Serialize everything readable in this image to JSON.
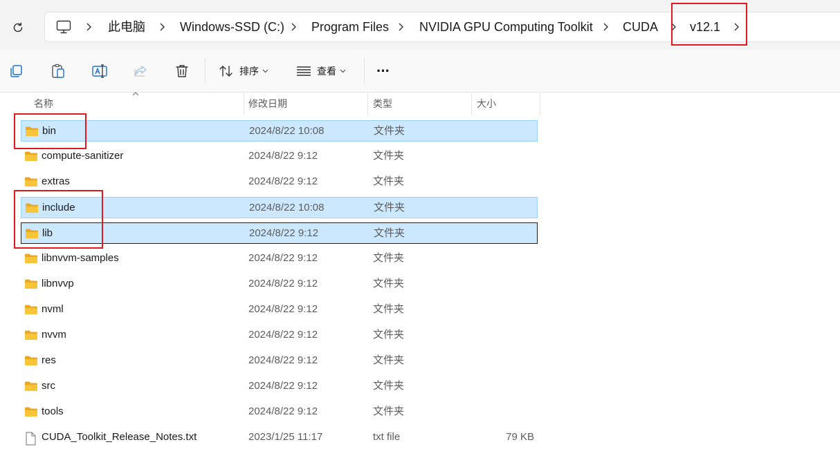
{
  "address_bar": {
    "breadcrumbs": [
      {
        "label": "此电脑"
      },
      {
        "label": "Windows-SSD (C:)"
      },
      {
        "label": "Program Files"
      },
      {
        "label": "NVIDIA GPU Computing Toolkit"
      },
      {
        "label": "CUDA"
      },
      {
        "label": "v12.1"
      }
    ]
  },
  "toolbar": {
    "sort_label": "排序",
    "view_label": "查看",
    "more_label": "···"
  },
  "columns": {
    "name": "名称",
    "date": "修改日期",
    "type": "类型",
    "size": "大小"
  },
  "files": [
    {
      "name": "bin",
      "date": "2024/8/22 10:08",
      "type": "文件夹",
      "size": "",
      "kind": "folder",
      "selected": true
    },
    {
      "name": "compute-sanitizer",
      "date": "2024/8/22 9:12",
      "type": "文件夹",
      "size": "",
      "kind": "folder",
      "selected": false
    },
    {
      "name": "extras",
      "date": "2024/8/22 9:12",
      "type": "文件夹",
      "size": "",
      "kind": "folder",
      "selected": false
    },
    {
      "name": "include",
      "date": "2024/8/22 10:08",
      "type": "文件夹",
      "size": "",
      "kind": "folder",
      "selected": true
    },
    {
      "name": "lib",
      "date": "2024/8/22 9:12",
      "type": "文件夹",
      "size": "",
      "kind": "folder",
      "selected": true,
      "focused": true
    },
    {
      "name": "libnvvm-samples",
      "date": "2024/8/22 9:12",
      "type": "文件夹",
      "size": "",
      "kind": "folder",
      "selected": false
    },
    {
      "name": "libnvvp",
      "date": "2024/8/22 9:12",
      "type": "文件夹",
      "size": "",
      "kind": "folder",
      "selected": false
    },
    {
      "name": "nvml",
      "date": "2024/8/22 9:12",
      "type": "文件夹",
      "size": "",
      "kind": "folder",
      "selected": false
    },
    {
      "name": "nvvm",
      "date": "2024/8/22 9:12",
      "type": "文件夹",
      "size": "",
      "kind": "folder",
      "selected": false
    },
    {
      "name": "res",
      "date": "2024/8/22 9:12",
      "type": "文件夹",
      "size": "",
      "kind": "folder",
      "selected": false
    },
    {
      "name": "src",
      "date": "2024/8/22 9:12",
      "type": "文件夹",
      "size": "",
      "kind": "folder",
      "selected": false
    },
    {
      "name": "tools",
      "date": "2024/8/22 9:12",
      "type": "文件夹",
      "size": "",
      "kind": "folder",
      "selected": false
    },
    {
      "name": "CUDA_Toolkit_Release_Notes.txt",
      "date": "2023/1/25 11:17",
      "type": "txt file",
      "size": "79 KB",
      "kind": "file",
      "selected": false
    }
  ],
  "colors": {
    "selection_bg": "#cce8ff",
    "selection_border": "#99d1ff",
    "annotation_red": "#e0191f",
    "folder_yellow": "#f8c53a"
  }
}
